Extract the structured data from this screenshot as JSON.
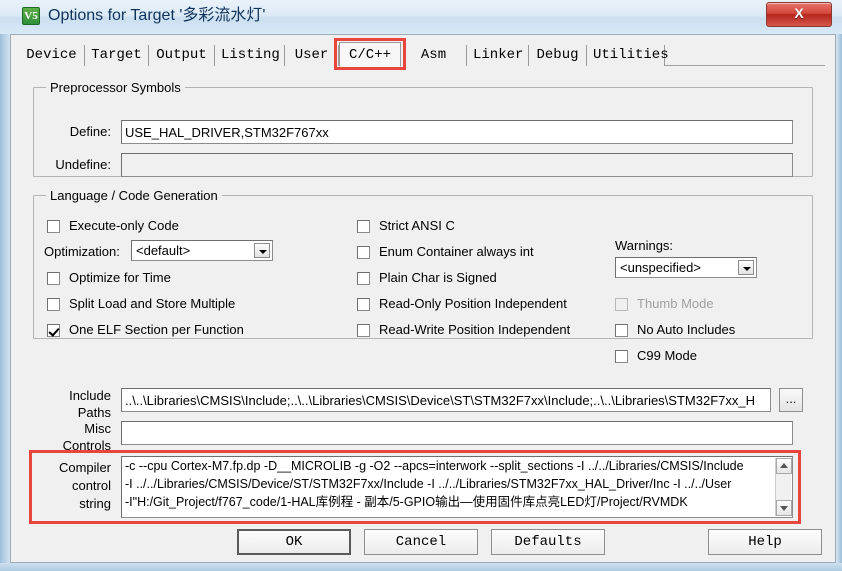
{
  "window": {
    "title": "Options for Target '多彩流水灯'",
    "app_icon_text": "V5",
    "close_label": "X"
  },
  "tabs": [
    {
      "label": "Device",
      "active": false
    },
    {
      "label": "Target",
      "active": false
    },
    {
      "label": "Output",
      "active": false
    },
    {
      "label": "Listing",
      "active": false
    },
    {
      "label": "User",
      "active": false
    },
    {
      "label": "C/C++",
      "active": true
    },
    {
      "label": "Asm",
      "active": false
    },
    {
      "label": "Linker",
      "active": false
    },
    {
      "label": "Debug",
      "active": false
    },
    {
      "label": "Utilities",
      "active": false
    }
  ],
  "preprocessor": {
    "group_title": "Preprocessor Symbols",
    "define_label": "Define:",
    "define_value": "USE_HAL_DRIVER,STM32F767xx",
    "undefine_label": "Undefine:",
    "undefine_value": ""
  },
  "language": {
    "group_title": "Language / Code Generation",
    "col1": [
      {
        "label": "Execute-only Code",
        "checked": false,
        "disabled": false
      },
      {
        "label": "Optimize for Time",
        "checked": false,
        "disabled": false
      },
      {
        "label": "Split Load and Store Multiple",
        "checked": false,
        "disabled": false
      },
      {
        "label": "One ELF Section per Function",
        "checked": true,
        "disabled": false
      }
    ],
    "optimization_label": "Optimization:",
    "optimization_value": "<default>",
    "col2": [
      {
        "label": "Strict ANSI C",
        "checked": false,
        "disabled": false
      },
      {
        "label": "Enum Container always int",
        "checked": false,
        "disabled": false
      },
      {
        "label": "Plain Char is Signed",
        "checked": false,
        "disabled": false
      },
      {
        "label": "Read-Only Position Independent",
        "checked": false,
        "disabled": false
      },
      {
        "label": "Read-Write Position Independent",
        "checked": false,
        "disabled": false
      }
    ],
    "warnings_label": "Warnings:",
    "warnings_value": "<unspecified>",
    "col3": [
      {
        "label": "Thumb Mode",
        "checked": false,
        "disabled": true
      },
      {
        "label": "No Auto Includes",
        "checked": false,
        "disabled": false
      },
      {
        "label": "C99 Mode",
        "checked": false,
        "disabled": false
      }
    ]
  },
  "paths": {
    "include_label_1": "Include",
    "include_label_2": "Paths",
    "include_value": "..\\..\\Libraries\\CMSIS\\Include;..\\..\\Libraries\\CMSIS\\Device\\ST\\STM32F7xx\\Include;..\\..\\Libraries\\STM32F7xx_H",
    "browse_label": "...",
    "misc_label_1": "Misc",
    "misc_label_2": "Controls",
    "misc_value": ""
  },
  "compiler": {
    "label_1": "Compiler",
    "label_2": "control",
    "label_3": "string",
    "lines": [
      "-c --cpu Cortex-M7.fp.dp -D__MICROLIB -g -O2 --apcs=interwork --split_sections -I ../../Libraries/CMSIS/Include",
      "-I ../../Libraries/CMSIS/Device/ST/STM32F7xx/Include -I ../../Libraries/STM32F7xx_HAL_Driver/Inc -I ../../User",
      "-I\"H:/Git_Project/f767_code/1-HAL库例程 - 副本/5-GPIO输出—使用固件库点亮LED灯/Project/RVMDK"
    ]
  },
  "buttons": {
    "ok": "OK",
    "cancel": "Cancel",
    "defaults": "Defaults",
    "help": "Help"
  },
  "colors": {
    "annotation_red": "#e8453c",
    "dialog_bg": "#f0f0f0",
    "title_text": "#10335c"
  }
}
